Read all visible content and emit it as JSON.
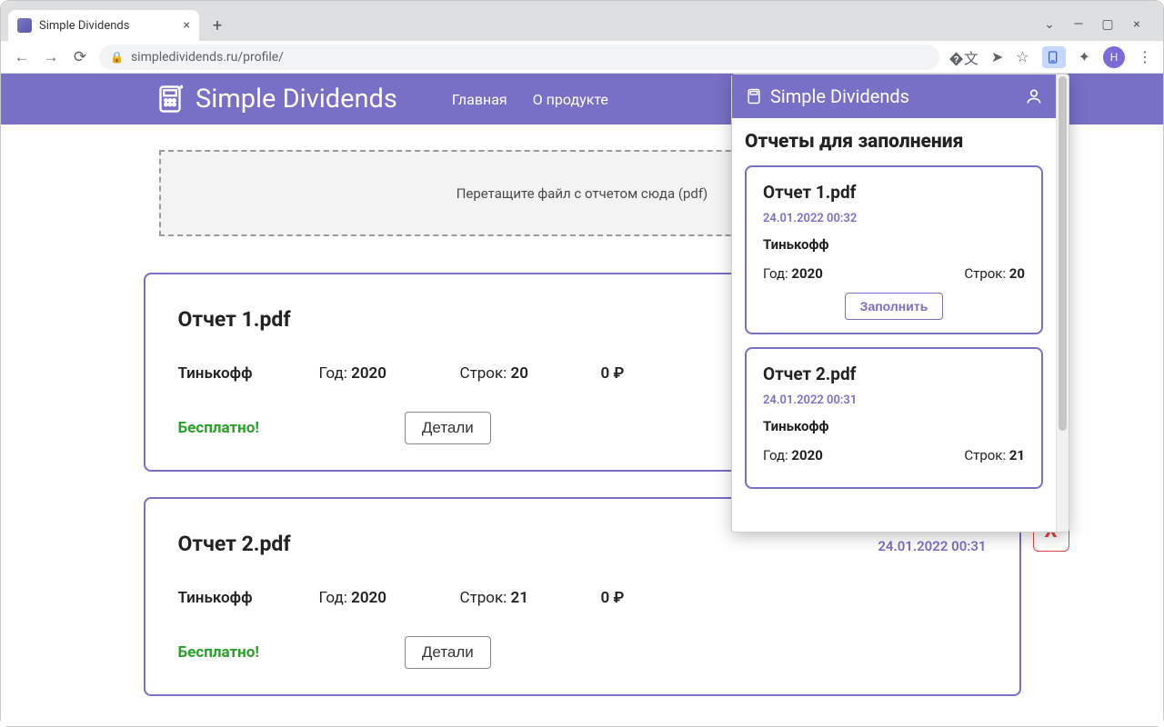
{
  "browser": {
    "tab_title": "Simple Dividends",
    "url": "simpledividends.ru/profile/",
    "avatar_letter": "H"
  },
  "header": {
    "brand": "Simple Dividends",
    "links": [
      "Главная",
      "О продукте"
    ]
  },
  "dropzone": {
    "text": "Перетащите файл с отчетом сюда (pdf)"
  },
  "meta_labels": {
    "year": "Год:",
    "rows": "Строк:",
    "details": "Детали",
    "delete": "X"
  },
  "currency": "₽",
  "reports": [
    {
      "title": "Отчет 1.pdf",
      "time": "24.01.2022 00:32",
      "broker": "Тинькофф",
      "year": "2020",
      "rows": "20",
      "cost": "0",
      "free_label": "Бесплатно!",
      "has_delete": false
    },
    {
      "title": "Отчет 2.pdf",
      "time": "24.01.2022 00:31",
      "broker": "Тинькофф",
      "year": "2020",
      "rows": "21",
      "cost": "0",
      "free_label": "Бесплатно!",
      "has_delete": true
    }
  ],
  "ext": {
    "brand": "Simple Dividends",
    "heading": "Отчеты для заполнения",
    "fill_label": "Заполнить",
    "items": [
      {
        "title": "Отчет 1.pdf",
        "time": "24.01.2022 00:32",
        "broker": "Тинькофф",
        "year": "2020",
        "rows": "20",
        "show_fill": true
      },
      {
        "title": "Отчет 2.pdf",
        "time": "24.01.2022 00:31",
        "broker": "Тинькофф",
        "year": "2020",
        "rows": "21",
        "show_fill": false
      }
    ]
  }
}
